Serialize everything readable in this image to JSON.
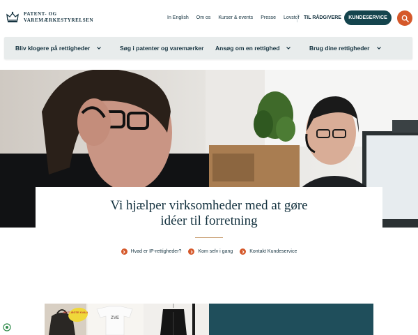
{
  "header": {
    "logo_line1": "PATENT- OG",
    "logo_line2": "VAREMÆRKESTYRELSEN",
    "topnav": [
      "In English",
      "Om os",
      "Kurser & events",
      "Presse",
      "Lovstof"
    ],
    "raadgivere": "TIL RÅDGIVERE",
    "kundeservice": "KUNDESERVICE",
    "search_icon": "search-icon",
    "colors": {
      "primary": "#14444d",
      "accent": "#d5582a"
    }
  },
  "mainnav": {
    "items": [
      {
        "label": "Bliv klogere på rettigheder"
      },
      {
        "label": "Søg i patenter og varemærker"
      },
      {
        "label": "Ansøg om en rettighed"
      },
      {
        "label": "Brug dine rettigheder"
      }
    ]
  },
  "hero": {
    "title_line1": "Vi hjælper virksomheder med at gøre",
    "title_line2": "idéer til forretning",
    "links": [
      {
        "label": "Hvad er IP-rettigheder?"
      },
      {
        "label": "Kom selv i gang"
      },
      {
        "label": "Kontakt Kundeservice"
      }
    ]
  },
  "bottom": {
    "sticker_text": "HELT ÆGTE KVALITET"
  }
}
